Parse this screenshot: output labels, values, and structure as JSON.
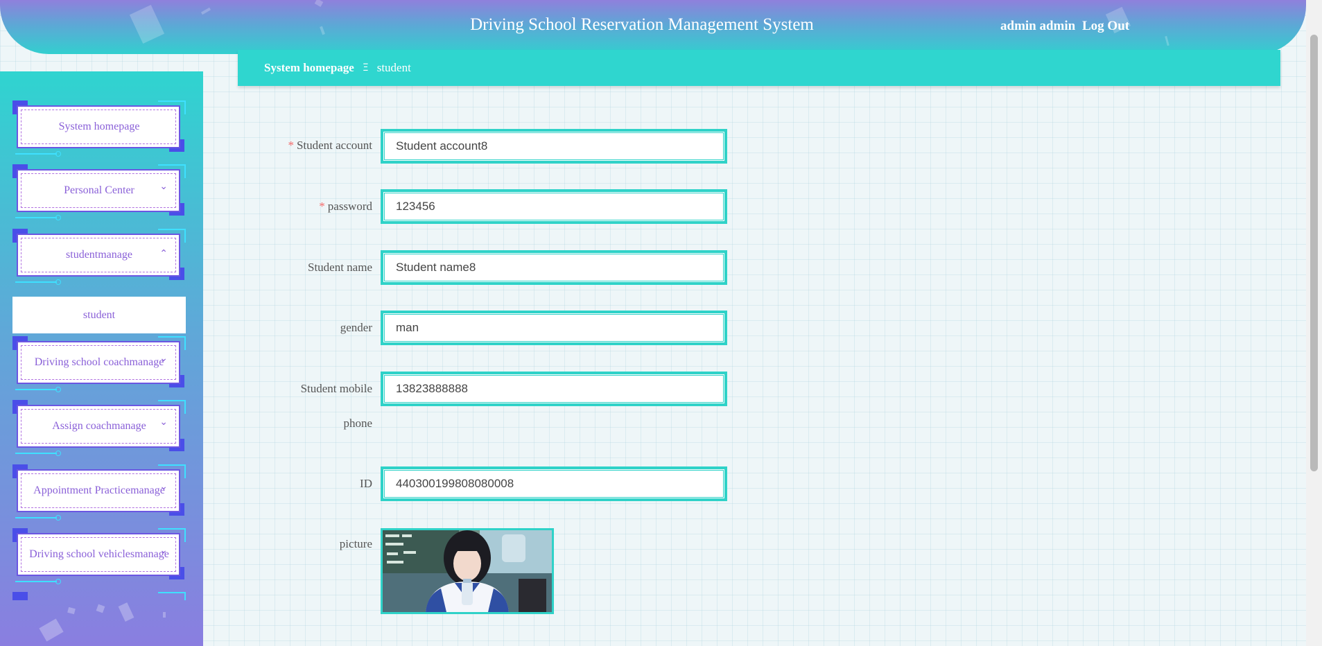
{
  "header": {
    "title": "Driving School Reservation Management System",
    "user": "admin admin",
    "logout_label": "Log Out"
  },
  "breadcrumb": {
    "home": "System homepage",
    "separator": "Ξ",
    "current": "student"
  },
  "sidebar": {
    "items": [
      {
        "label": "System homepage",
        "chevron": ""
      },
      {
        "label": "Personal Center",
        "chevron": "⌄"
      },
      {
        "label": "studentmanage",
        "chevron": "⌃"
      },
      {
        "label": "Driving school coachmanage",
        "chevron": "⌄"
      },
      {
        "label": "Assign coachmanage",
        "chevron": "⌄"
      },
      {
        "label": "Appointment Practicemanage",
        "chevron": "⌄"
      },
      {
        "label": "Driving school vehiclesmanage",
        "chevron": "⌄"
      }
    ],
    "submenu": {
      "label": "student"
    }
  },
  "form": {
    "student_account": {
      "label": "Student account",
      "required": "*",
      "value": "Student account8"
    },
    "password": {
      "label": "password",
      "required": "*",
      "value": "123456"
    },
    "student_name": {
      "label": "Student name",
      "value": "Student name8"
    },
    "gender": {
      "label": "gender",
      "value": "man"
    },
    "mobile": {
      "label_line1": "Student mobile",
      "label_line2": "phone",
      "value": "13823888888"
    },
    "id": {
      "label": "ID",
      "value": "440300199808080008"
    },
    "picture": {
      "label": "picture"
    }
  },
  "colors": {
    "accent": "#2fd6cf",
    "menu_text": "#8a60d8",
    "required": "#f56c6c"
  }
}
